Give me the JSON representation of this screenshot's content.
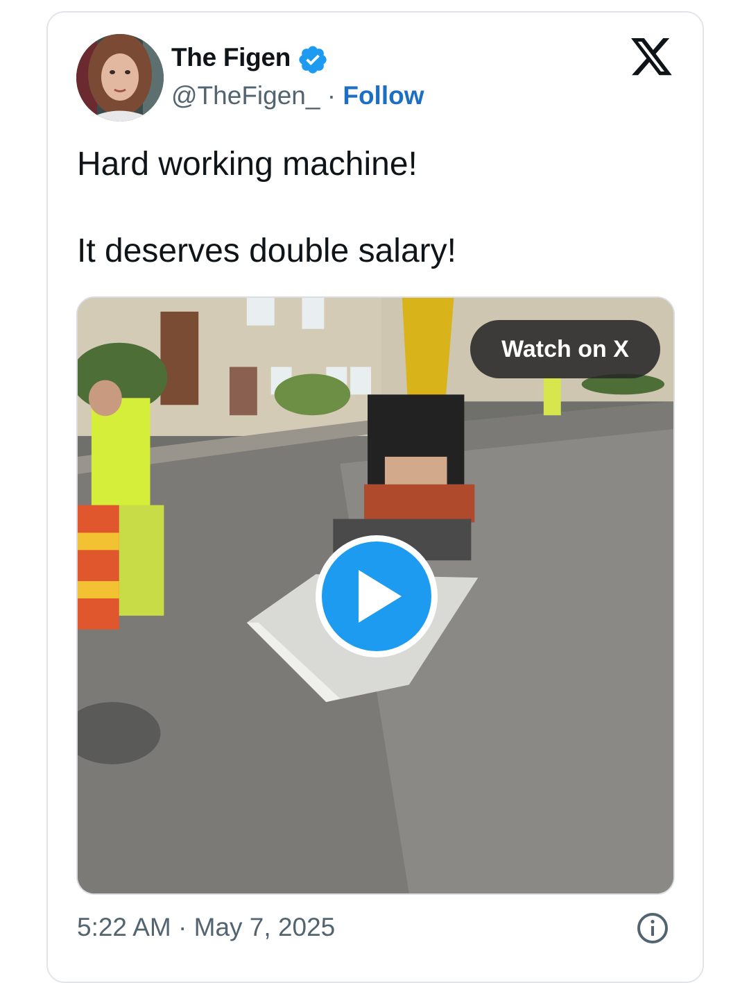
{
  "tweet": {
    "author": {
      "name": "The Figen",
      "handle": "@TheFigen_",
      "separator": "·",
      "follow_label": "Follow",
      "verified": true,
      "avatar": "profile-photo"
    },
    "brand_icon": "x-logo-icon",
    "text_lines": [
      "Hard working machine!",
      "It deserves double salary!"
    ],
    "media": {
      "type": "video",
      "watch_label": "Watch on X",
      "play_icon": "play-icon",
      "description_icon": "video-thumbnail-excavator"
    },
    "timestamp": "5:22 AM · May 7, 2025",
    "info_icon": "info-icon"
  },
  "colors": {
    "follow": "#1d6fc2",
    "verified": "#1d9bf0",
    "play_button": "#1d9bf0",
    "secondary_text": "#536471",
    "primary_text": "#0f1419",
    "card_border": "#e1e5ea"
  }
}
